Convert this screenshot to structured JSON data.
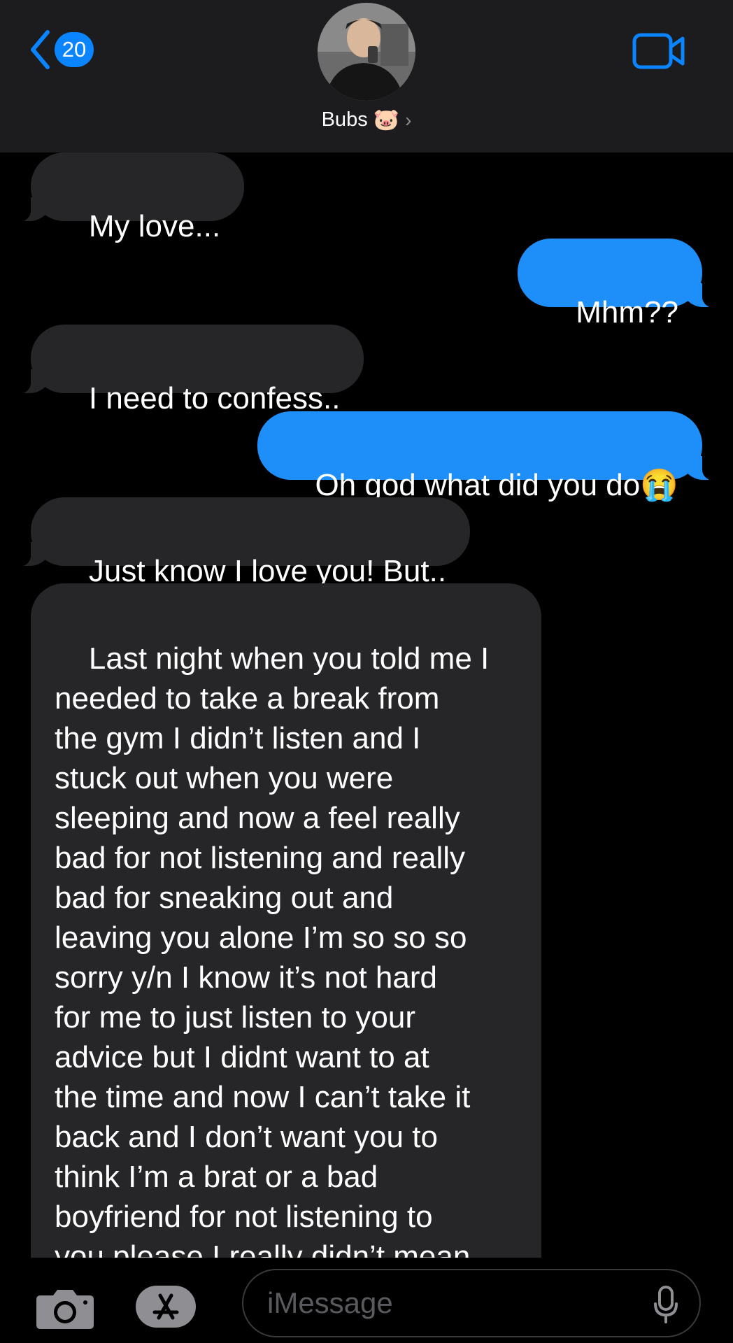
{
  "header": {
    "back_count": "20",
    "contact_name": "Bubs",
    "contact_emoji": "🐷",
    "chevron": "›",
    "icons": [
      "chevron-left-icon",
      "video-camera-icon"
    ]
  },
  "messages": [
    {
      "from": "them",
      "text": "My love..."
    },
    {
      "from": "me",
      "text": "Mhm??"
    },
    {
      "from": "them",
      "text": "I need to confess.."
    },
    {
      "from": "me",
      "text": "Oh god what did you do😭"
    },
    {
      "from": "them",
      "text": "Just know I love you! But.."
    },
    {
      "from": "them",
      "text": "Last night when you told me I\nneeded to take a break from\nthe gym I didn’t listen and I\nstuck out when you were\nsleeping and now a feel really\nbad for not listening and really\nbad for sneaking out and\nleaving you alone I’m so so so\nsorry y/n I know it’s not hard\nfor me to just listen to your\nadvice but I didnt want to at\nthe time and now I can’t take it\nback and I don’t want you to\nthink I’m a brat or a bad\nboyfriend for not listening to\nyou please I really didn’t mean\ntoo!!!!🥺 🥺"
    }
  ],
  "composer": {
    "placeholder": "iMessage",
    "icons": [
      "camera-icon",
      "app-store-icon",
      "microphone-icon"
    ]
  },
  "colors": {
    "accent": "#0a84ff",
    "outgoing_bubble": "#1e8ef8",
    "incoming_bubble": "#262628",
    "header_bg": "#1c1c1e"
  }
}
